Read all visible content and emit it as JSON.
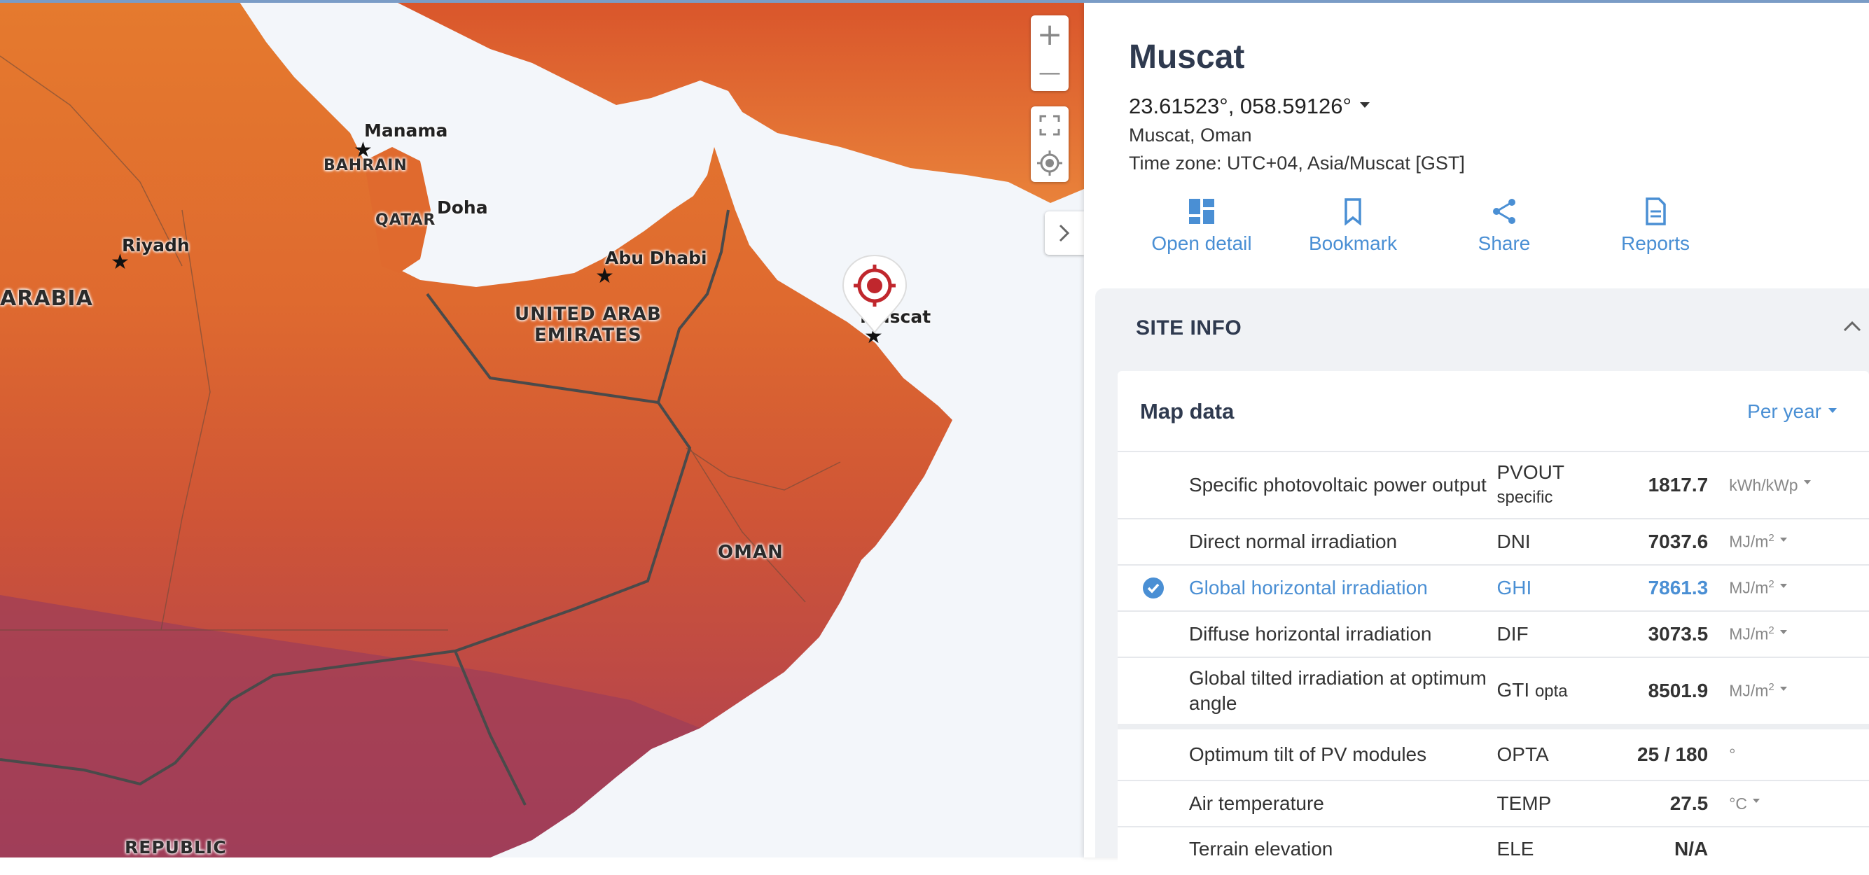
{
  "map": {
    "cities": [
      {
        "id": "manama",
        "label": "Manama"
      },
      {
        "id": "doha",
        "label": "Doha"
      },
      {
        "id": "riyadh",
        "label": "Riyadh"
      },
      {
        "id": "abu-dhabi",
        "label": "Abu Dhabi"
      },
      {
        "id": "muscat",
        "label": "Muscat"
      }
    ],
    "countries": {
      "bahrain": "BAHRAIN",
      "qatar": "QATAR",
      "arabia": "ARABIA",
      "uae_line1": "UNITED ARAB",
      "uae_line2": "EMIRATES",
      "oman": "OMAN",
      "republic": "REPUBLIC"
    },
    "controls": {
      "zoom_in": "+",
      "zoom_out": "—"
    }
  },
  "panel": {
    "title": "Muscat",
    "coordinates": "23.61523°, 058.59126°",
    "location": "Muscat, Oman",
    "timezone": "Time zone: UTC+04, Asia/Muscat [GST]",
    "actions": [
      {
        "label": "Open detail",
        "icon": "dashboard-icon"
      },
      {
        "label": "Bookmark",
        "icon": "bookmark-icon"
      },
      {
        "label": "Share",
        "icon": "share-icon"
      },
      {
        "label": "Reports",
        "icon": "document-icon"
      }
    ]
  },
  "site_info": {
    "heading": "SITE INFO",
    "card_title": "Map data",
    "period": "Per year",
    "rows": [
      {
        "name": "Specific photovoltaic power output",
        "abbr": "PVOUT",
        "abbr_sub": "specific",
        "value": "1817.7",
        "unit": "kWh/kWp",
        "unit_sup": "",
        "has_dropdown": true,
        "selected": false
      },
      {
        "name": "Direct normal irradiation",
        "abbr": "DNI",
        "abbr_sub": "",
        "value": "7037.6",
        "unit": "MJ/m",
        "unit_sup": "2",
        "has_dropdown": true,
        "selected": false
      },
      {
        "name": "Global horizontal irradiation",
        "abbr": "GHI",
        "abbr_sub": "",
        "value": "7861.3",
        "unit": "MJ/m",
        "unit_sup": "2",
        "has_dropdown": true,
        "selected": true
      },
      {
        "name": "Diffuse horizontal irradiation",
        "abbr": "DIF",
        "abbr_sub": "",
        "value": "3073.5",
        "unit": "MJ/m",
        "unit_sup": "2",
        "has_dropdown": true,
        "selected": false
      },
      {
        "name": "Global tilted irradiation at optimum angle",
        "abbr": "GTI",
        "abbr_sub": "opta",
        "value": "8501.9",
        "unit": "MJ/m",
        "unit_sup": "2",
        "has_dropdown": true,
        "selected": false
      },
      {
        "name": "Optimum tilt of PV modules",
        "abbr": "OPTA",
        "abbr_sub": "",
        "value": "25 /  180",
        "unit": "°",
        "unit_sup": "",
        "has_dropdown": false,
        "selected": false
      },
      {
        "name": "Air temperature",
        "abbr": "TEMP",
        "abbr_sub": "",
        "value": "27.5",
        "unit": "°C",
        "unit_sup": "",
        "has_dropdown": true,
        "selected": false
      },
      {
        "name": "Terrain elevation",
        "abbr": "ELE",
        "abbr_sub": "",
        "value": "N/A",
        "unit": "",
        "unit_sup": "",
        "has_dropdown": false,
        "selected": false
      }
    ]
  },
  "colors": {
    "accent": "#4a8fd4",
    "title": "#2f3a4f",
    "pin_red": "#c0272d"
  }
}
